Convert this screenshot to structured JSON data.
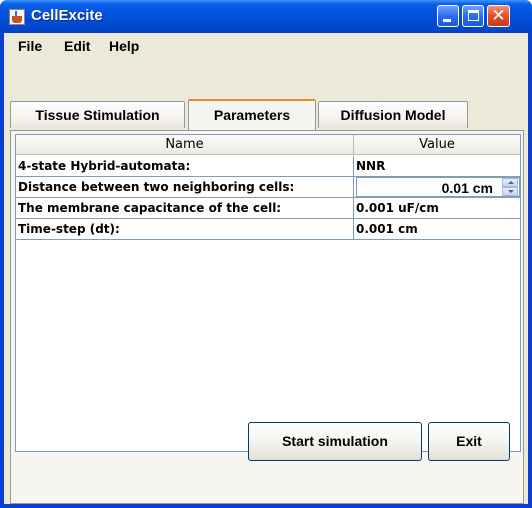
{
  "window": {
    "title": "CellExcite",
    "icon": "java-cup-icon",
    "controls": {
      "minimize": "minimize-icon",
      "maximize": "maximize-icon",
      "close": "close-icon",
      "close_glyph": "✕"
    }
  },
  "menubar": {
    "items": [
      {
        "label": "File"
      },
      {
        "label": "Edit"
      },
      {
        "label": "Help"
      }
    ]
  },
  "tabs": [
    {
      "label": "Tissue Stimulation",
      "selected": false
    },
    {
      "label": "Parameters",
      "selected": true
    },
    {
      "label": "Diffusion Model",
      "selected": false
    }
  ],
  "table": {
    "columns": [
      "Name",
      "Value"
    ],
    "rows": [
      {
        "name": "4-state Hybrid-automata:",
        "value": "NNR"
      },
      {
        "name": "Distance between two neighboring cells:",
        "value": "0.01 cm"
      },
      {
        "name": "The membrane capacitance of the cell:",
        "value": "0.001 uF/cm"
      },
      {
        "name": "Time-step (dt):",
        "value": "0.001 cm"
      }
    ]
  },
  "buttons": {
    "start": "Start simulation",
    "exit": "Exit"
  },
  "colors": {
    "titlebar": "#0253dd",
    "window_bg": "#ece9d8",
    "active_tab_accent": "#e68b2c"
  }
}
